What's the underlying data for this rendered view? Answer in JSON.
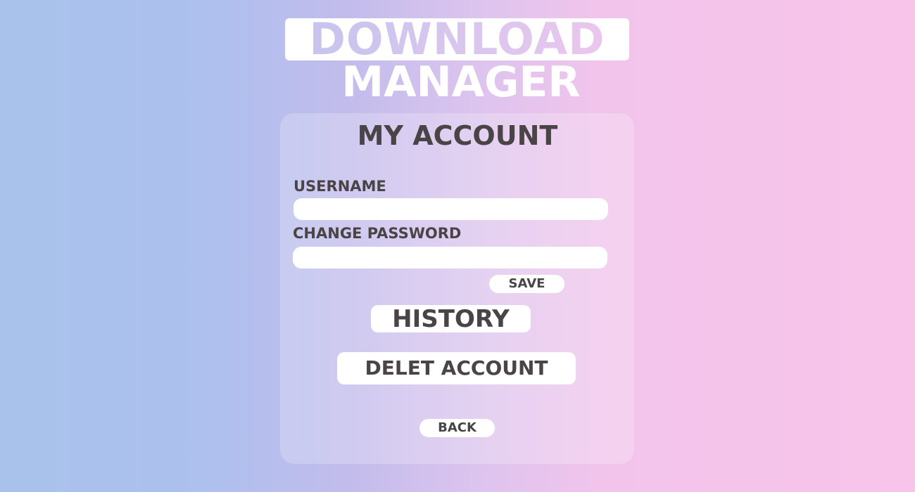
{
  "logo": {
    "line1": "DOWNLOAD",
    "line2": "MANAGER"
  },
  "account": {
    "title": "MY ACCOUNT",
    "username_label": "USERNAME",
    "username_value": "",
    "password_label": "CHANGE PASSWORD",
    "password_value": "",
    "save_label": "SAVE",
    "history_label": "HISTORY",
    "delete_label": "DELET ACCOUNT",
    "back_label": "BACK"
  },
  "colors": {
    "background_left": "#a8c2ec",
    "background_right": "#f8c4ea",
    "text": "#4a4446",
    "button_bg": "#ffffff"
  }
}
